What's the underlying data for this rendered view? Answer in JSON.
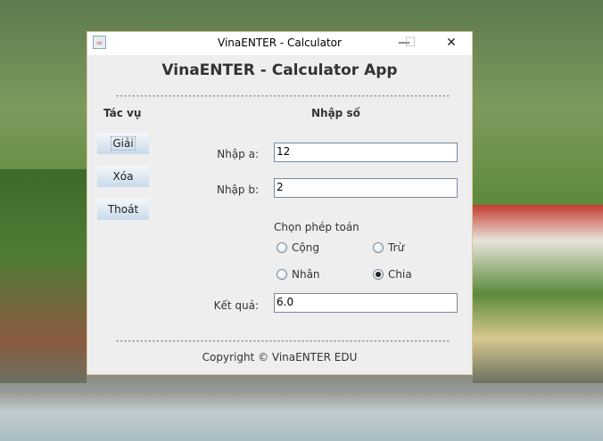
{
  "window": {
    "title": "VinaENTER - Calculator",
    "minimize": "—",
    "maximize": "☐",
    "close": "✕"
  },
  "app_title": "VinaENTER - Calculator App",
  "divider": "------------------------------------------------------------------------------------------",
  "actions": {
    "heading": "Tác vụ",
    "solve": "Giải",
    "clear": "Xóa",
    "exit": "Thoát"
  },
  "inputs": {
    "heading": "Nhập số",
    "a_label": "Nhập a:",
    "a_value": "12",
    "b_label": "Nhập b:",
    "b_value": "2"
  },
  "operation": {
    "label": "Chọn phép toán",
    "options": [
      "Cộng",
      "Trừ",
      "Nhân",
      "Chia"
    ],
    "selected": "Chia"
  },
  "result": {
    "label": "Kết quả:",
    "value": "6.0"
  },
  "footer": "Copyright © VinaENTER EDU"
}
